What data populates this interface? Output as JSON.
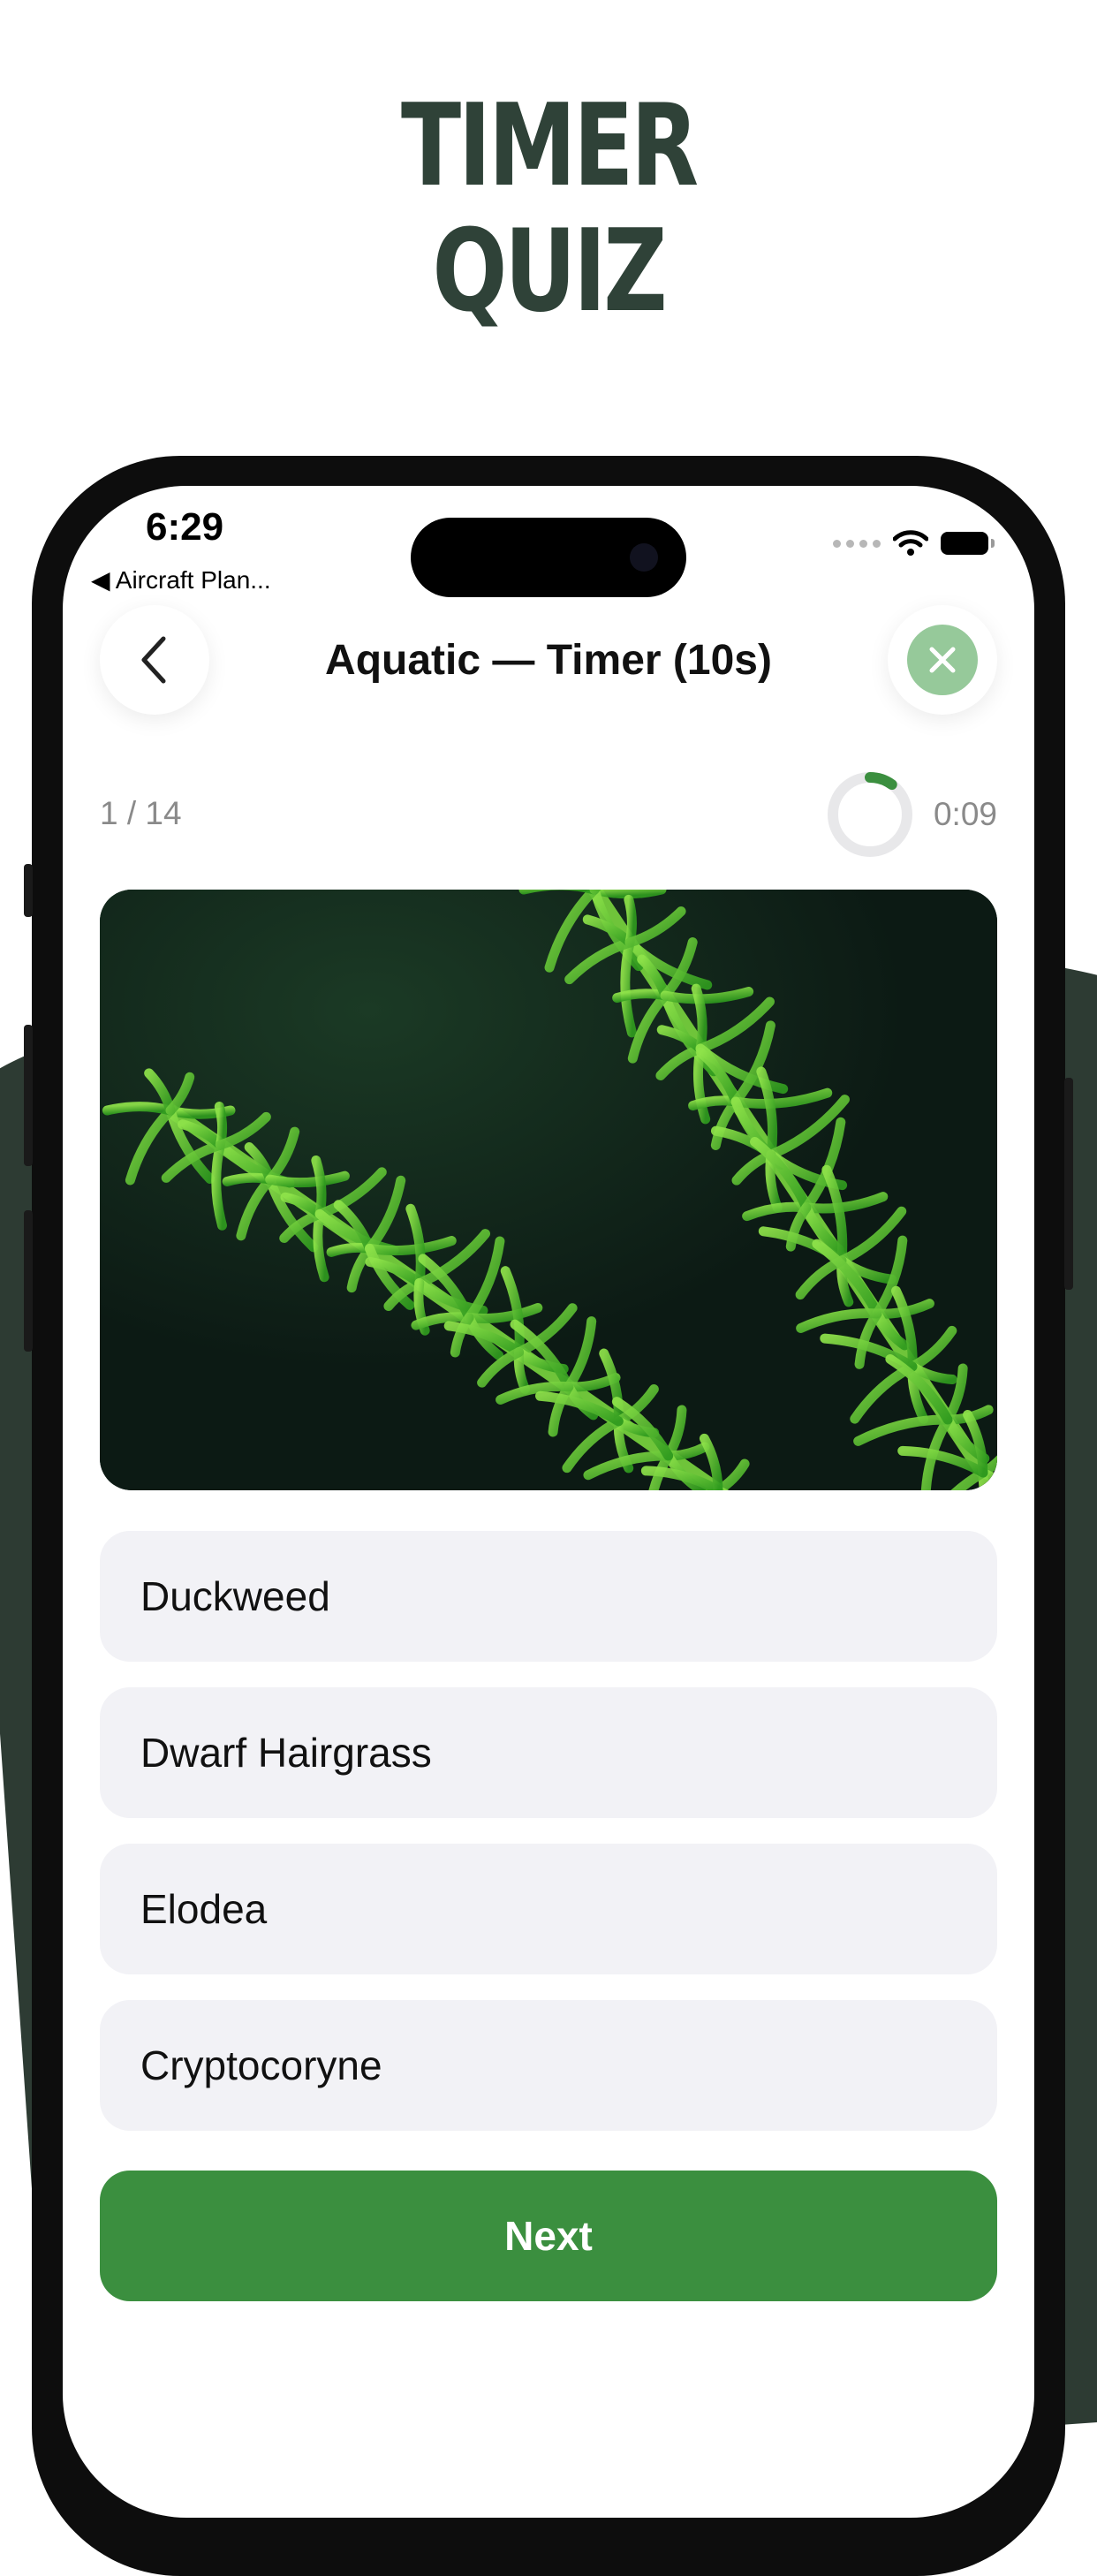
{
  "promo": {
    "headline_line1": "TIMER",
    "headline_line2": "QUIZ"
  },
  "status_bar": {
    "time": "6:29",
    "back_app": "◀ Aircraft Plan..."
  },
  "header": {
    "title": "Aquatic — Timer (10s)",
    "back_icon": "chevron-left-icon",
    "close_icon": "close-icon"
  },
  "progress": {
    "counter": "1 / 14",
    "timer": "0:09",
    "timer_fraction_elapsed": 0.1
  },
  "question": {
    "image": "aquatic plant photo (green stem plant on dark background)"
  },
  "answers": [
    {
      "label": "Duckweed"
    },
    {
      "label": "Dwarf Hairgrass"
    },
    {
      "label": "Elodea"
    },
    {
      "label": "Cryptocoryne"
    }
  ],
  "actions": {
    "next_label": "Next"
  },
  "colors": {
    "accent": "#3b8f3f",
    "headline": "#2f4238",
    "close_bg": "#96c99a",
    "answer_bg": "#f2f2f6",
    "promo_bg": "#2d3b33"
  }
}
